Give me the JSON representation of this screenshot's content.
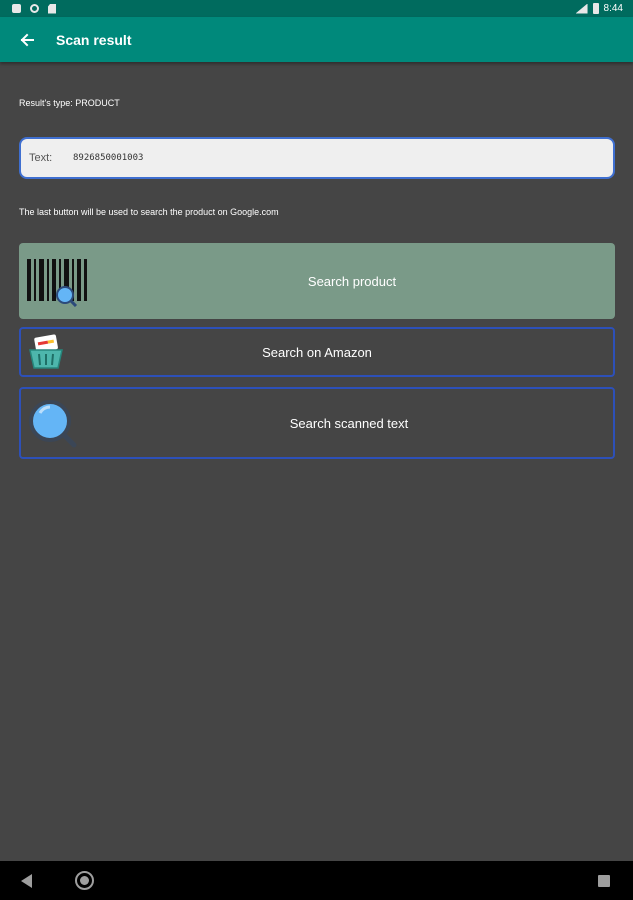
{
  "status_bar": {
    "time": "8:44",
    "left_icons": [
      "notification-square-icon",
      "sync-circle-icon",
      "file-icon"
    ],
    "right_icons": [
      "signal-icon",
      "battery-icon"
    ]
  },
  "app_bar": {
    "title": "Scan result",
    "back_icon": "arrow-left-icon",
    "color": "#00897b"
  },
  "result": {
    "type_text": "Result's type: PRODUCT",
    "field_label": "Text:",
    "field_value": "8926850001003",
    "hint": "The last button will be used to search the product on Google.com"
  },
  "buttons": {
    "search_product": {
      "label": "Search product",
      "icon": "barcode-search-icon",
      "color": "#7a9a88"
    },
    "search_amazon": {
      "label": "Search on Amazon",
      "icon": "shopping-basket-icon"
    },
    "search_scanned": {
      "label": "Search scanned text",
      "icon": "magnifier-icon"
    }
  },
  "nav_bar": {
    "icons": [
      "nav-back-icon",
      "nav-home-icon",
      "nav-recent-icon"
    ]
  }
}
